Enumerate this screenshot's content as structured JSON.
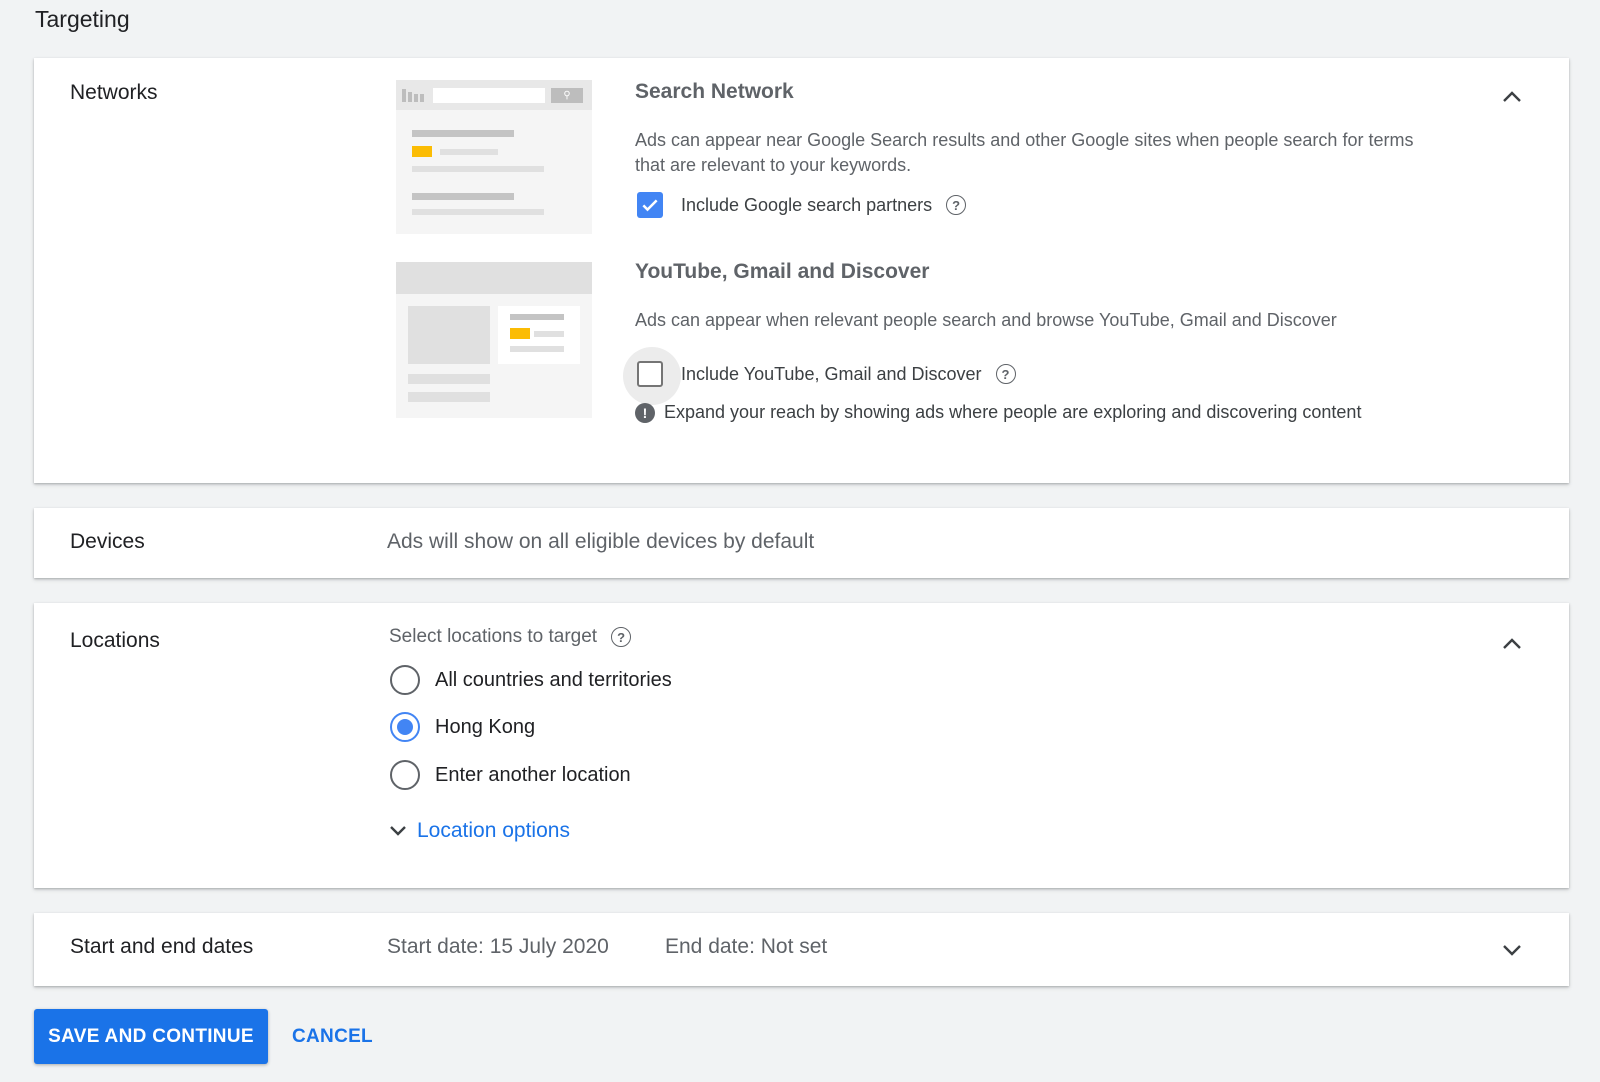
{
  "page": {
    "title": "Targeting"
  },
  "networks": {
    "label": "Networks",
    "search": {
      "title": "Search Network",
      "description": "Ads can appear near Google Search results and other Google sites when people search for terms that are relevant to your keywords.",
      "checkbox_label": "Include Google search partners",
      "checked": true
    },
    "youtube": {
      "title": "YouTube, Gmail and Discover",
      "description": "Ads can appear when relevant people search and browse YouTube, Gmail and Discover",
      "checkbox_label": "Include YouTube, Gmail and Discover",
      "checked": false,
      "info": "Expand your reach by showing ads where people are exploring and discovering content"
    }
  },
  "devices": {
    "label": "Devices",
    "summary": "Ads will show on all eligible devices by default"
  },
  "locations": {
    "label": "Locations",
    "prompt": "Select locations to target",
    "options": [
      {
        "label": "All countries and territories",
        "selected": false
      },
      {
        "label": "Hong Kong",
        "selected": true
      },
      {
        "label": "Enter another location",
        "selected": false
      }
    ],
    "more_options": "Location options"
  },
  "dates": {
    "label": "Start and end dates",
    "start": "Start date: 15 July 2020",
    "end": "End date: Not set"
  },
  "actions": {
    "primary": "SAVE AND CONTINUE",
    "secondary": "CANCEL"
  },
  "colors": {
    "accent": "#1a73e8",
    "checkbox": "#4285f4",
    "illustration_highlight": "#fbbc04"
  }
}
